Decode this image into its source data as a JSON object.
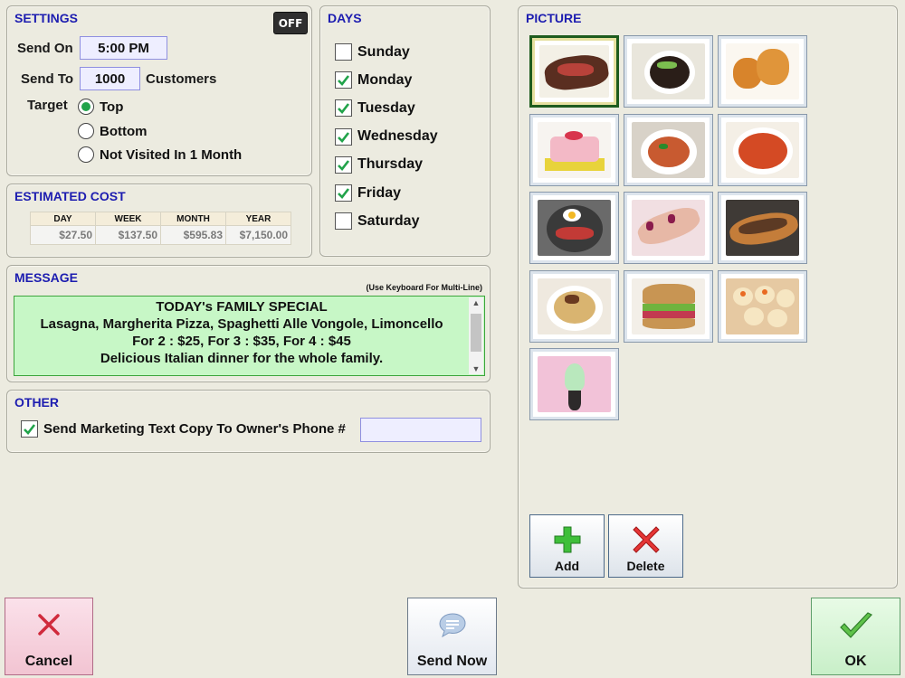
{
  "settings": {
    "title": "SETTINGS",
    "toggle_label": "OFF",
    "send_on_label": "Send On",
    "send_on_value": "5:00 PM",
    "send_to_label": "Send To",
    "send_to_value": "1000",
    "customers_label": "Customers",
    "target_label": "Target",
    "target_options": [
      {
        "label": "Top",
        "selected": true
      },
      {
        "label": "Bottom",
        "selected": false
      },
      {
        "label": "Not Visited In 1 Month",
        "selected": false
      }
    ]
  },
  "estimated_cost": {
    "title": "ESTIMATED COST",
    "headers": [
      "DAY",
      "WEEK",
      "MONTH",
      "YEAR"
    ],
    "values": [
      "$27.50",
      "$137.50",
      "$595.83",
      "$7,150.00"
    ]
  },
  "days": {
    "title": "DAYS",
    "items": [
      {
        "label": "Sunday",
        "checked": false
      },
      {
        "label": "Monday",
        "checked": true
      },
      {
        "label": "Tuesday",
        "checked": true
      },
      {
        "label": "Wednesday",
        "checked": true
      },
      {
        "label": "Thursday",
        "checked": true
      },
      {
        "label": "Friday",
        "checked": true
      },
      {
        "label": "Saturday",
        "checked": false
      }
    ]
  },
  "message": {
    "title": "MESSAGE",
    "hint": "(Use Keyboard For Multi-Line)",
    "lines": [
      "TODAY's FAMILY SPECIAL",
      "Lasagna, Margherita Pizza, Spaghetti Alle Vongole, Limoncello",
      "For 2 : $25, For 3 : $35, For 4 : $45",
      "Delicious Italian dinner for the whole family."
    ]
  },
  "other": {
    "title": "OTHER",
    "copy_checked": true,
    "copy_label": "Send Marketing Text Copy To Owner's Phone #",
    "phone_value": ""
  },
  "picture": {
    "title": "PICTURE",
    "tiles": [
      {
        "name": "steak",
        "selected": true
      },
      {
        "name": "noodle-bowl",
        "selected": false
      },
      {
        "name": "fried-chicken",
        "selected": false
      },
      {
        "name": "cake",
        "selected": false
      },
      {
        "name": "spaghetti",
        "selected": false
      },
      {
        "name": "spicy-soup",
        "selected": false
      },
      {
        "name": "cold-noodles",
        "selected": false
      },
      {
        "name": "nails",
        "selected": false
      },
      {
        "name": "cheesesteak",
        "selected": false
      },
      {
        "name": "ramen",
        "selected": false
      },
      {
        "name": "sandwich",
        "selected": false
      },
      {
        "name": "dumplings",
        "selected": false
      },
      {
        "name": "ice-cream",
        "selected": false
      }
    ],
    "add_label": "Add",
    "delete_label": "Delete"
  },
  "buttons": {
    "cancel": "Cancel",
    "send_now": "Send Now",
    "ok": "OK"
  },
  "colors": {
    "accent_title": "#1d1db0",
    "message_bg": "#c7f7c6",
    "check_green": "#21a34a"
  }
}
